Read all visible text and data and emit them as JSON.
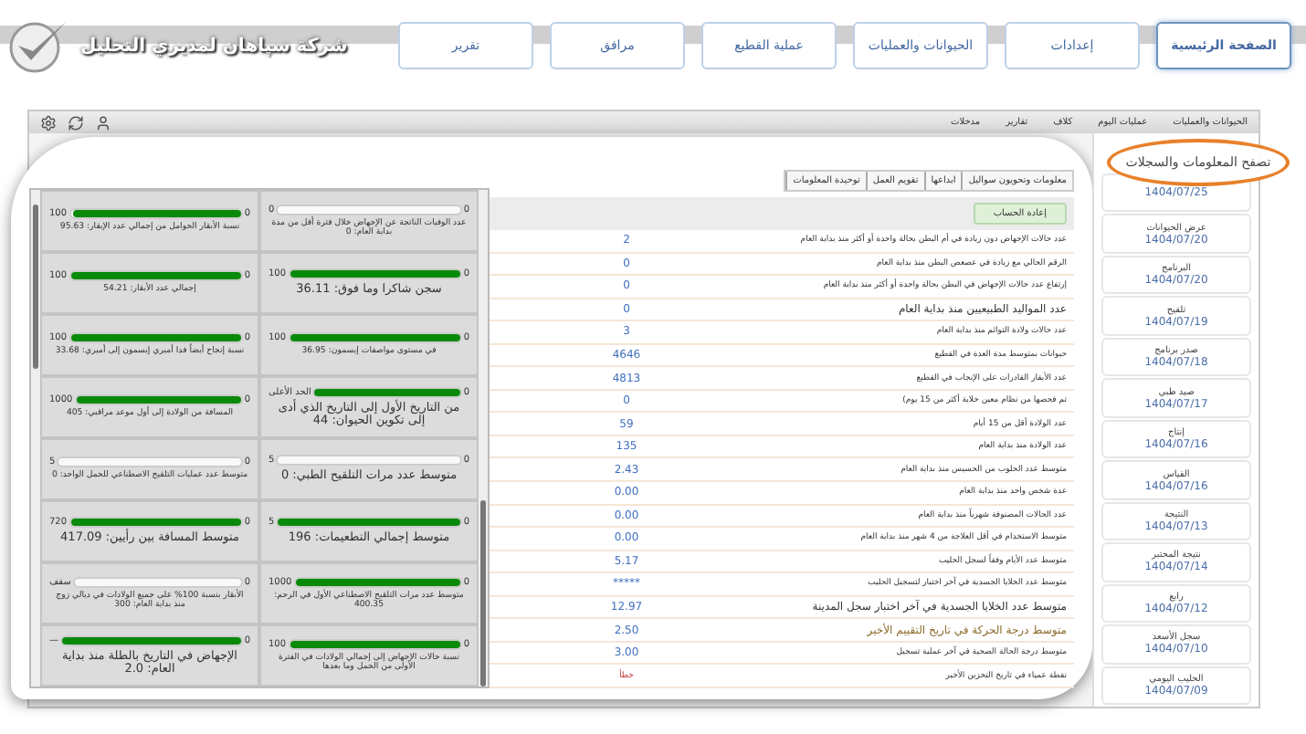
{
  "header": {
    "title": "شركة سپاهان لمديري التحليل",
    "nav": [
      {
        "label": "الصفحة الرئيسية",
        "selected": true
      },
      {
        "label": "إعدادات",
        "selected": false
      },
      {
        "label": "الحيوانات والعمليات",
        "selected": false
      },
      {
        "label": "عملية القطيع",
        "selected": false
      },
      {
        "label": "مرافق",
        "selected": false
      },
      {
        "label": "تقرير",
        "selected": false
      }
    ]
  },
  "toolbar": {
    "tabs": [
      "الحيوانات والعمليات",
      "عمليات اليوم",
      "كلاف",
      "تقارير",
      "مدخلات"
    ]
  },
  "callout": "تصفح المعلومات والسجلات",
  "sidebar": {
    "items": [
      {
        "date": "1404/07/25"
      },
      {
        "label": "عرض الحيوانات",
        "date": "1404/07/20"
      },
      {
        "label": "البرنامج",
        "date": "1404/07/20"
      },
      {
        "label": "تلقيح",
        "date": "1404/07/19"
      },
      {
        "label": "صدر برنامج",
        "date": "1404/07/18"
      },
      {
        "label": "صيد طبي",
        "date": "1404/07/17"
      },
      {
        "label": "إنتاج",
        "date": "1404/07/16"
      },
      {
        "label": "القياس",
        "date": "1404/07/16"
      },
      {
        "label": "النتيجة",
        "date": "1404/07/13"
      },
      {
        "label": "نتيجة المختبر",
        "date": "1404/07/14"
      },
      {
        "label": "رابع",
        "date": "1404/07/12"
      },
      {
        "label": "سجل الأسعد",
        "date": "1404/07/10"
      },
      {
        "label": "الحليب اليومي",
        "date": "1404/07/09"
      }
    ]
  },
  "info_tabs": [
    "معلومات وتحويون سواليل",
    "ابداعها",
    "تقويم العمل",
    "توحيدة المعلومات"
  ],
  "recalc_button": "إعادة الحساب",
  "indicators": [
    {
      "label": "عدد حالات الإجهاض دون زيادة في أم البطن بحالة واحدة أو أكثر منذ بداية العام",
      "value": "2",
      "kind": "normal"
    },
    {
      "label": "الرقم الحالي مع زيادة في عصعص البطن منذ بداية العام",
      "value": "0",
      "kind": "normal"
    },
    {
      "label": "إرتفاع عدد حالات الإجهاض في البطن بحالة واحدة أو أكثر منذ بداية العام",
      "value": "0",
      "kind": "normal"
    },
    {
      "label": "عدد المواليد الطبيعيين منذ بداية العام",
      "value": "0",
      "kind": "large"
    },
    {
      "label": "عدد حالات ولادة التوائم منذ بداية العام",
      "value": "3",
      "kind": "normal"
    },
    {
      "label": "حيوانات بمتوسط مدة العدة في القطيع",
      "value": "4646",
      "kind": "normal"
    },
    {
      "label": "عدد الأبقار القادرات على الإنجاب في القطيع",
      "value": "4813",
      "kind": "normal"
    },
    {
      "label": "تم فحصها من نظام معين خلاية أكثر من 15 يوم)",
      "value": "0",
      "kind": "normal"
    },
    {
      "label": "عدد الولادة أقل من 15 أيام",
      "value": "59",
      "kind": "normal"
    },
    {
      "label": "عدد الولادة منذ بداية العام",
      "value": "135",
      "kind": "normal"
    },
    {
      "label": "متوسط عدد الحلوب من الحسيس منذ بداية العام",
      "value": "2.43",
      "kind": "normal"
    },
    {
      "label": "عدة شخص واحد منذ بداية العام",
      "value": "0.00",
      "kind": "normal"
    },
    {
      "label": "عدد الحالات المصنوفة شهرياً منذ بداية العام",
      "value": "0.00",
      "kind": "normal"
    },
    {
      "label": "متوسط الاستخدام في أقل العلاجة من 4 شهر منذ بداية العام",
      "value": "0.00",
      "kind": "normal"
    },
    {
      "label": "متوسط عدد الأيام وفقاً لسجل الحليب",
      "value": "5.17",
      "kind": "normal"
    },
    {
      "label": "متوسط عدد الخلايا الجسدية في آخر اختبار لتسجيل الحليب",
      "value": "*****",
      "kind": "normal"
    },
    {
      "label": "متوسط عدد الخلايا الجسدية في آخر اختبار سجل المدينة",
      "value": "12.97",
      "kind": "large"
    },
    {
      "label": "متوسط درجة الحركة في تاريخ التقييم الأخير",
      "value": "2.50",
      "kind": "highlight"
    },
    {
      "label": "متوسط درجة الحالة الصحية في آخر عملية تسجيل",
      "value": "3.00",
      "kind": "normal"
    },
    {
      "label": "نقطة عمياء في تاريخ التخزين الأخير",
      "value": "خطأ",
      "kind": "alert"
    }
  ],
  "gauges": [
    {
      "caption": "عدد الوفيات الناتجة عن الإجهاض خلال فترة أقل من مدة بداية العام: 0",
      "min": "0",
      "max": "0",
      "level": 0
    },
    {
      "caption": "نسبة الأبقار الحوامل من إجمالي عدد الإبقار: 95.63",
      "min": "0",
      "max": "100",
      "level": 0.98
    },
    {
      "caption": "سجن شاكرا وما فوق: 36.11",
      "min": "0",
      "max": "100",
      "level": 1,
      "large": true
    },
    {
      "caption": "إجمالي عدد الأبقار: 54.21",
      "min": "0",
      "max": "100",
      "level": 1
    },
    {
      "caption": "في مستوى مواصفات إيسمون: 36.95",
      "min": "0",
      "max": "100",
      "level": 1
    },
    {
      "caption": "نسبة إنجاح أيضاً فدا أميري إيسمون إلى أميري: 33.68",
      "min": "0",
      "max": "100",
      "level": 1
    },
    {
      "caption": "من التاريخ الأول إلى التاريخ الذي أدى إلى تكوين الحيوان: 44",
      "min": "0",
      "max": "الحد الأعلى",
      "level": 1,
      "large": true
    },
    {
      "caption": "المسافة من الولادة إلى أول موعد مراقبي: 405",
      "min": "0",
      "max": "1000",
      "level": 1
    },
    {
      "caption": "متوسط عدد مرات التلقيح الطبي: 0",
      "min": "0",
      "max": "5",
      "level": 0,
      "large": true
    },
    {
      "caption": "متوسط عدد عمليات التلقيح الاصطناعي للحمل الواحد: 0",
      "min": "0",
      "max": "5",
      "level": 0
    },
    {
      "caption": "متوسط إجمالي التطعيمات: 196",
      "min": "0",
      "max": "5",
      "level": 1,
      "large": true
    },
    {
      "caption": "متوسط المسافة بين رأيين: 417.09",
      "min": "0",
      "max": "720",
      "level": 1,
      "large": true
    },
    {
      "caption": "متوسط عدد مرات التلقيح الاصطناعي الأول في الرحم: 400.35",
      "min": "0",
      "max": "1000",
      "level": 1
    },
    {
      "caption": "الأبقار بنسبة 100% على جميع الولادات في ديالي زوج منذ بداية العام: 300",
      "min": "0",
      "max": "سقف",
      "level": 0
    },
    {
      "caption": "نسبة حالات الإجهاض إلى إجمالي الولادات في الفترة الأولى من الحمل وما بعدها",
      "min": "0",
      "max": "100",
      "level": 1
    },
    {
      "caption": "الإجهاض في التاريخ بالطلة منذ بداية العام: 2.0",
      "min": "0",
      "max": "—",
      "level": 1,
      "large": true
    }
  ]
}
